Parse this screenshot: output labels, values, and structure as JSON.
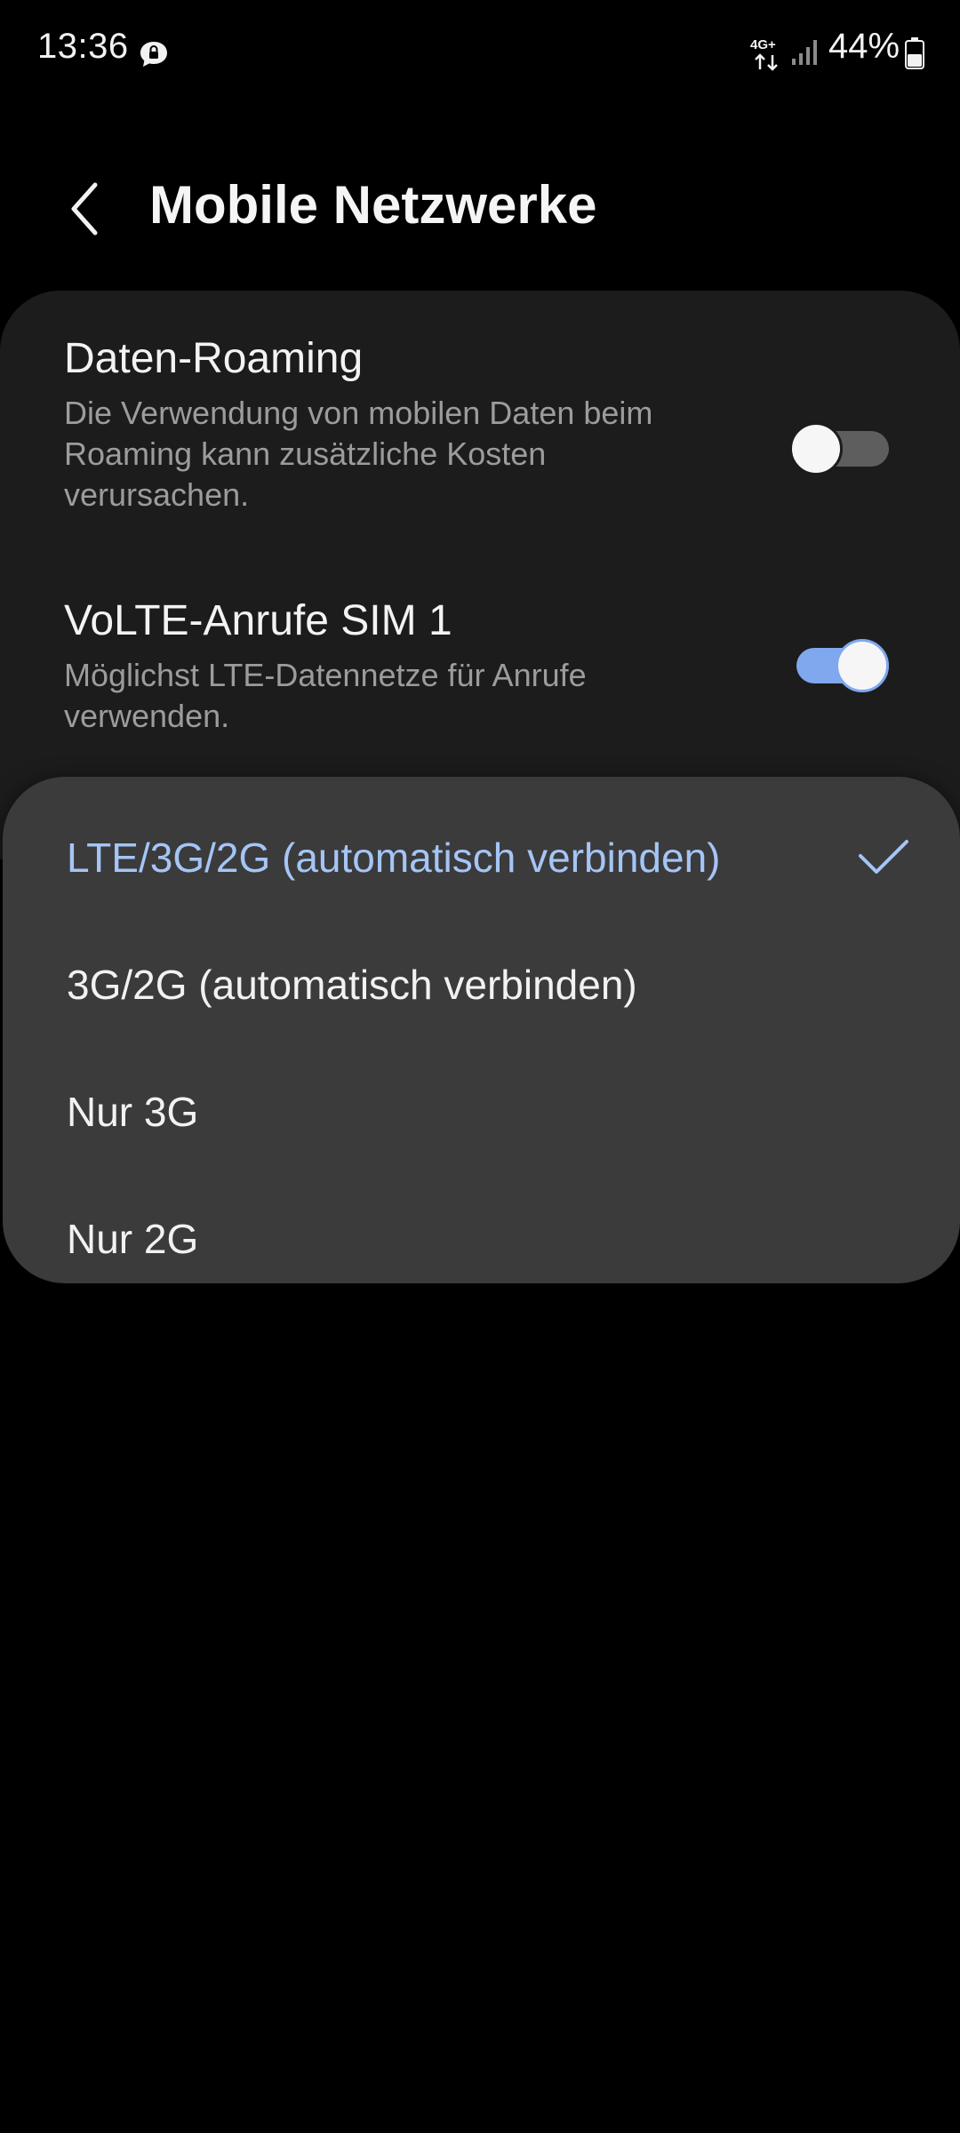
{
  "status_bar": {
    "time": "13:36",
    "network_type": "4G+",
    "battery_percent": "44%",
    "icons": [
      "message-icon",
      "network-4g-icon",
      "signal-icon",
      "battery-icon"
    ]
  },
  "header": {
    "back_icon": "chevron-left-icon",
    "title": "Mobile Netzwerke"
  },
  "settings": {
    "data_roaming": {
      "title": "Daten-Roaming",
      "description": "Die Verwendung von mobilen Daten beim Roaming kann zusätzliche Kosten verursachen.",
      "enabled": false
    },
    "volte": {
      "title": "VoLTE-Anrufe SIM 1",
      "description": "Möglichst LTE-Datennetze für Anrufe verwenden.",
      "enabled": true
    }
  },
  "network_mode_options": [
    {
      "label": "LTE/3G/2G (automatisch verbinden)",
      "selected": true
    },
    {
      "label": "3G/2G (automatisch verbinden)",
      "selected": false
    },
    {
      "label": "Nur 3G",
      "selected": false
    },
    {
      "label": "Nur 2G",
      "selected": false
    }
  ],
  "colors": {
    "accent": "#7fa8ee",
    "selected_text": "#a5c5f6",
    "background": "#000000",
    "card": "#1c1c1c",
    "popup": "#3b3b3c"
  }
}
